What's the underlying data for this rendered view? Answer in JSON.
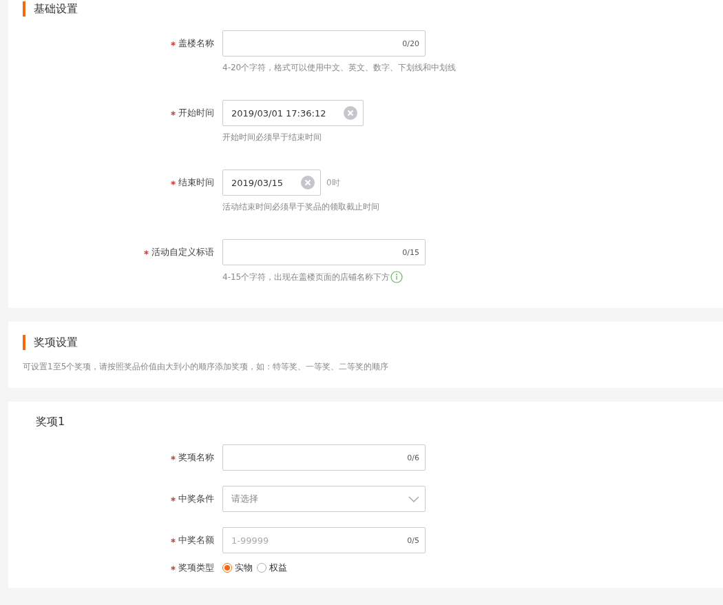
{
  "basic_section": {
    "title": "基础设置",
    "fields": [
      {
        "kind": "text",
        "label": "盖楼名称",
        "required": true,
        "counter": "0/20",
        "hint": "4-20个字符，格式可以使用中文、英文、数字、下划线和中划线"
      },
      {
        "kind": "date",
        "label": "开始时间",
        "required": true,
        "value": "2019/03/01 17:36:12",
        "hint": "开始时间必须早于结束时间"
      },
      {
        "kind": "date",
        "label": "结束时间",
        "required": true,
        "value": "2019/03/15",
        "suffix": "0时",
        "hint": "活动结束时间必须早于奖品的领取截止时间"
      },
      {
        "kind": "text",
        "label": "活动自定义标语",
        "required": true,
        "counter": "0/15",
        "hint": "4-15个字符，出现在盖楼页面的店铺名称下方",
        "info_icon": true
      }
    ]
  },
  "prize_section": {
    "title": "奖项设置",
    "description": "可设置1至5个奖项，请按照奖品价值由大到小的顺序添加奖项，如：特等奖、一等奖、二等奖的顺序"
  },
  "prize_1": {
    "title": "奖项1",
    "fields": [
      {
        "kind": "text",
        "label": "奖项名称",
        "required": true,
        "counter": "0/6"
      },
      {
        "kind": "select",
        "label": "中奖条件",
        "required": true,
        "placeholder": "请选择"
      },
      {
        "kind": "text",
        "label": "中奖名额",
        "required": true,
        "placeholder": "1-99999",
        "counter": "0/5"
      },
      {
        "kind": "radio",
        "label": "奖项类型",
        "required": true,
        "options": [
          {
            "label": "实物",
            "selected": true
          },
          {
            "label": "权益",
            "selected": false
          }
        ]
      }
    ]
  }
}
